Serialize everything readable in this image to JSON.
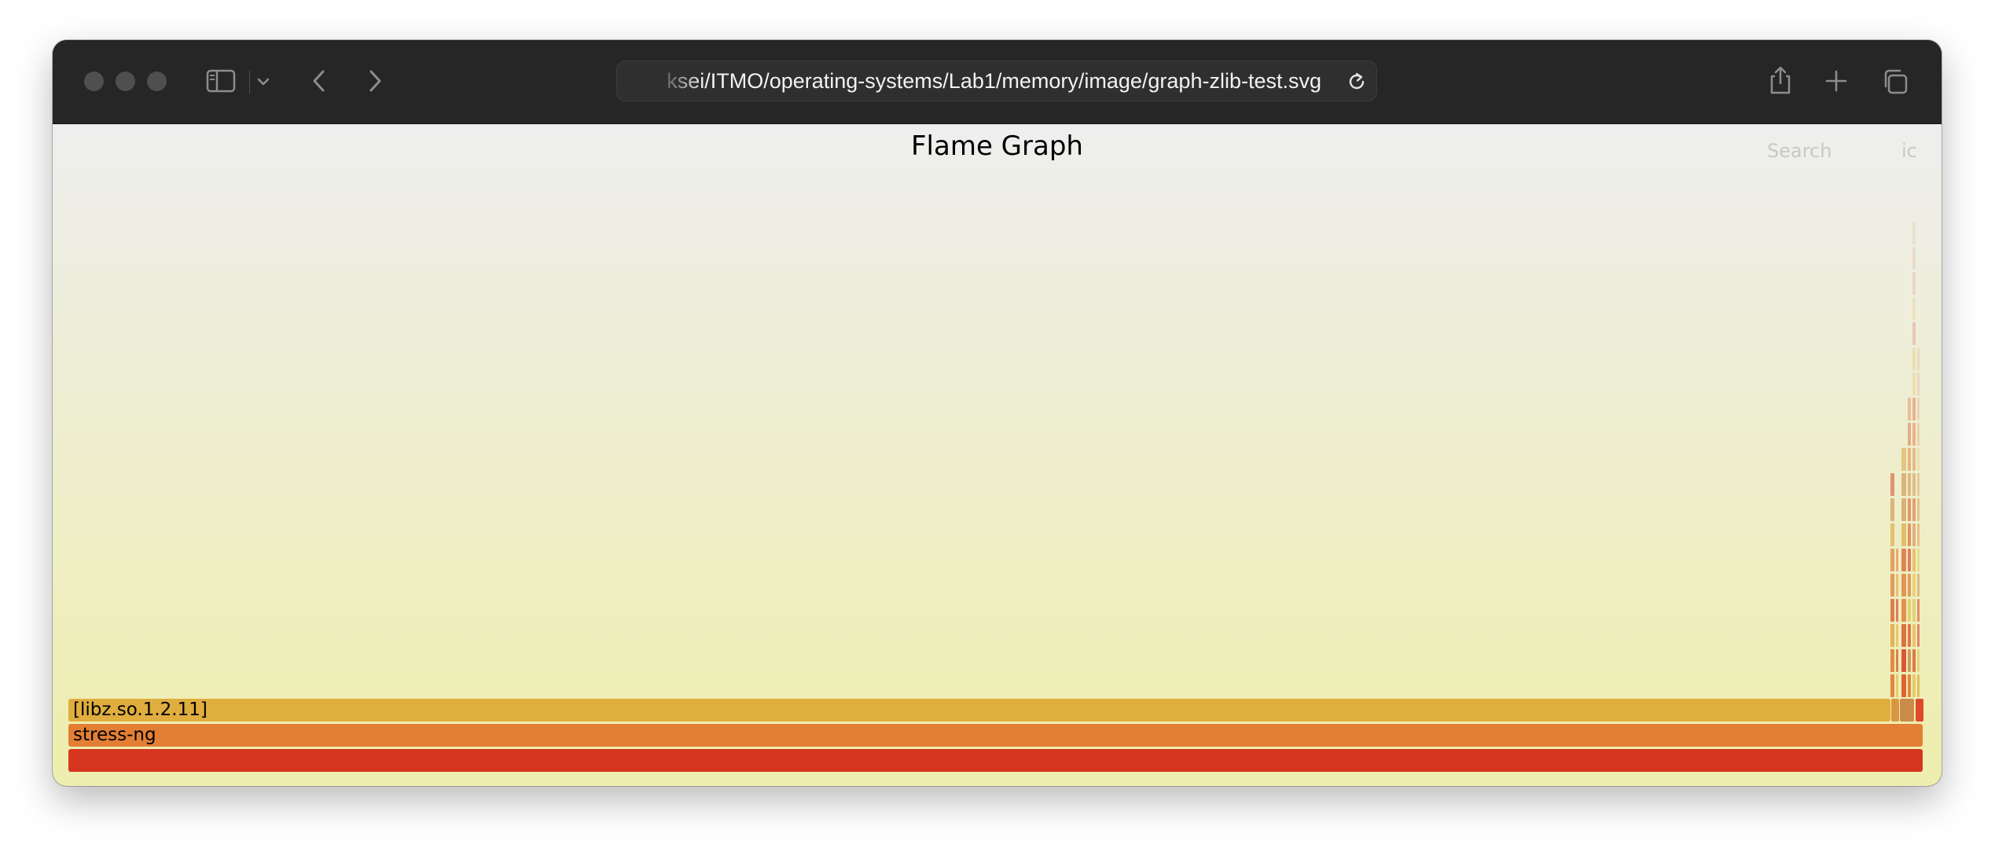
{
  "browser": {
    "url": "ksei/ITMO/operating-systems/Lab1/memory/image/graph-zlib-test.svg",
    "icons": {
      "sidebar": "sidebar-icon",
      "dropdown": "chevron-down-icon",
      "back": "back-icon",
      "forward": "forward-icon",
      "reload": "reload-icon",
      "share": "share-icon",
      "new_tab": "plus-icon",
      "tabs": "tabs-icon"
    }
  },
  "flamegraph": {
    "title": "Flame Graph",
    "search_label": "Search",
    "ic_label": "ic",
    "frames": [
      {
        "label": "[libz.so.1.2.11]",
        "color": "#e0ad3f"
      },
      {
        "label": "stress-ng",
        "color": "#e37f35"
      },
      {
        "label": "",
        "color": "#d63520"
      }
    ]
  }
}
